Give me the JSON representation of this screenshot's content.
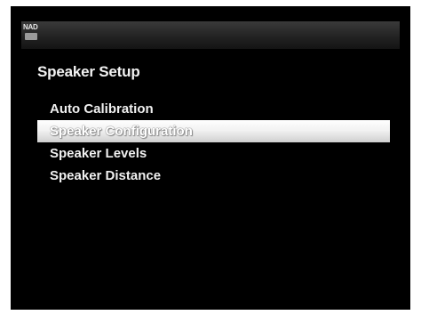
{
  "header": {
    "logo_text": "NAD"
  },
  "page": {
    "title": "Speaker Setup"
  },
  "menu": {
    "items": [
      {
        "label": "Auto Calibration",
        "selected": false
      },
      {
        "label": "Speaker Configuration",
        "selected": true
      },
      {
        "label": "Speaker Levels",
        "selected": false
      },
      {
        "label": "Speaker Distance",
        "selected": false
      }
    ]
  },
  "colors": {
    "screen_background": "#000000",
    "text": "#f0f0f0",
    "highlight": "#f2f2f2"
  }
}
